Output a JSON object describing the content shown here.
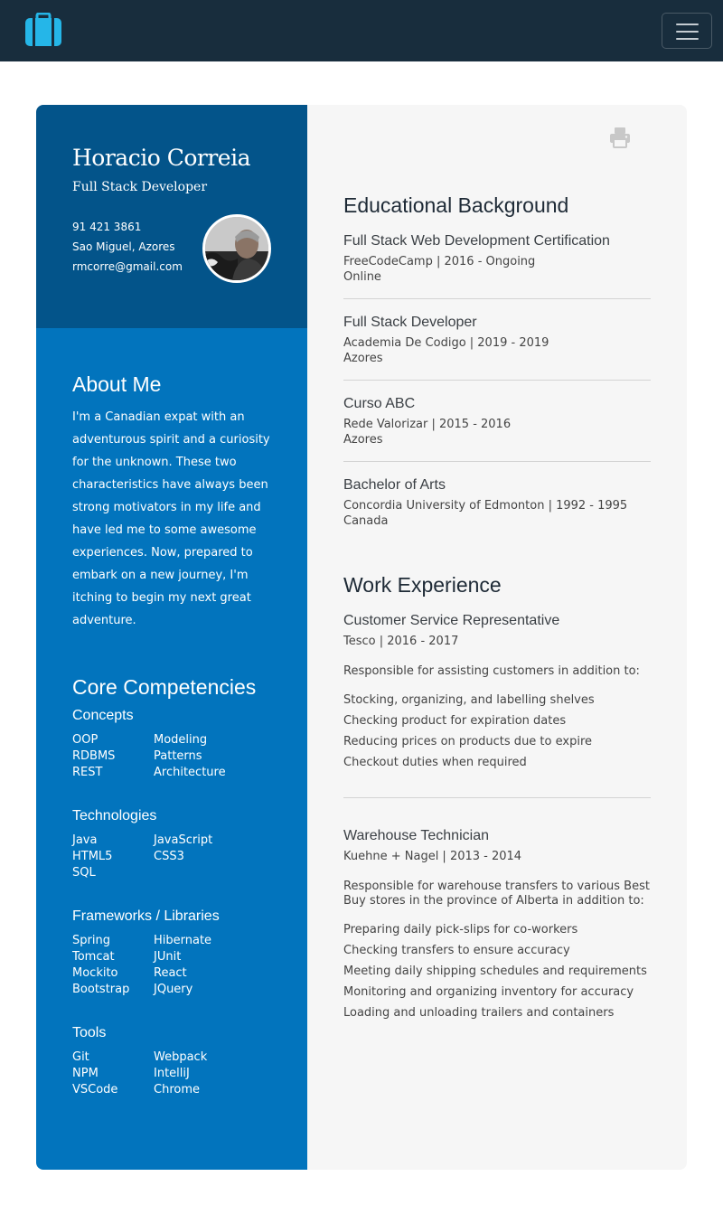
{
  "colors": {
    "navbar": "#182d3d",
    "brand": "#25b6e8",
    "header_panel": "#03548a",
    "sidebar": "#0274bd",
    "content_bg": "#f6f6f6"
  },
  "navbar": {
    "brand_icon": "briefcase-icon",
    "toggle_icon": "hamburger-icon"
  },
  "profile": {
    "name": "Horacio Correia",
    "title": "Full Stack Developer",
    "phone": "91 421 3861",
    "location": "Sao Miguel, Azores",
    "email": "rmcorre@gmail.com"
  },
  "about": {
    "heading": "About Me",
    "text": "I'm a Canadian expat with an adventurous spirit and a curiosity for the unknown. These two characteristics have always been strong motivators in my life and have led me to some awesome experiences. Now, prepared to embark on a new journey, I'm itching to begin my next great adventure."
  },
  "competencies": {
    "heading": "Core Competencies",
    "groups": [
      {
        "title": "Concepts",
        "items": [
          "OOP",
          "Modeling",
          "RDBMS",
          "Patterns",
          "REST",
          "Architecture"
        ]
      },
      {
        "title": "Technologies",
        "items": [
          "Java",
          "JavaScript",
          "HTML5",
          "CSS3",
          "SQL"
        ]
      },
      {
        "title": "Frameworks / Libraries",
        "items": [
          "Spring",
          "Hibernate",
          "Tomcat",
          "JUnit",
          "Mockito",
          "React",
          "Bootstrap",
          "JQuery"
        ]
      },
      {
        "title": "Tools",
        "items": [
          "Git",
          "Webpack",
          "NPM",
          "IntelliJ",
          "VSCode",
          "Chrome"
        ]
      }
    ]
  },
  "print_icon": "printer-icon",
  "education": {
    "heading": "Educational Background",
    "entries": [
      {
        "title": "Full Stack Web Development Certification",
        "sub": "FreeCodeCamp | 2016 - Ongoing",
        "loc": "Online"
      },
      {
        "title": "Full Stack Developer",
        "sub": "Academia De Codigo | 2019 - 2019",
        "loc": "Azores"
      },
      {
        "title": "Curso ABC",
        "sub": "Rede Valorizar | 2015 - 2016",
        "loc": "Azores"
      },
      {
        "title": "Bachelor of Arts",
        "sub": "Concordia University of Edmonton | 1992 - 1995",
        "loc": "Canada"
      }
    ]
  },
  "work": {
    "heading": "Work Experience",
    "jobs": [
      {
        "title": "Customer Service Representative",
        "sub": "Tesco | 2016 - 2017",
        "desc": "Responsible for assisting customers in addition to:",
        "bullets": [
          "Stocking, organizing, and labelling shelves",
          "Checking product for expiration dates",
          "Reducing prices on products due to expire",
          "Checkout duties when required"
        ]
      },
      {
        "title": "Warehouse Technician",
        "sub": "Kuehne + Nagel | 2013 - 2014",
        "desc": "Responsible for warehouse transfers to various Best Buy stores in the province of Alberta in addition to:",
        "bullets": [
          "Preparing daily pick-slips for co-workers",
          "Checking transfers to ensure accuracy",
          "Meeting daily shipping schedules and requirements",
          "Monitoring and organizing inventory for accuracy",
          "Loading and unloading trailers and containers"
        ]
      }
    ]
  }
}
